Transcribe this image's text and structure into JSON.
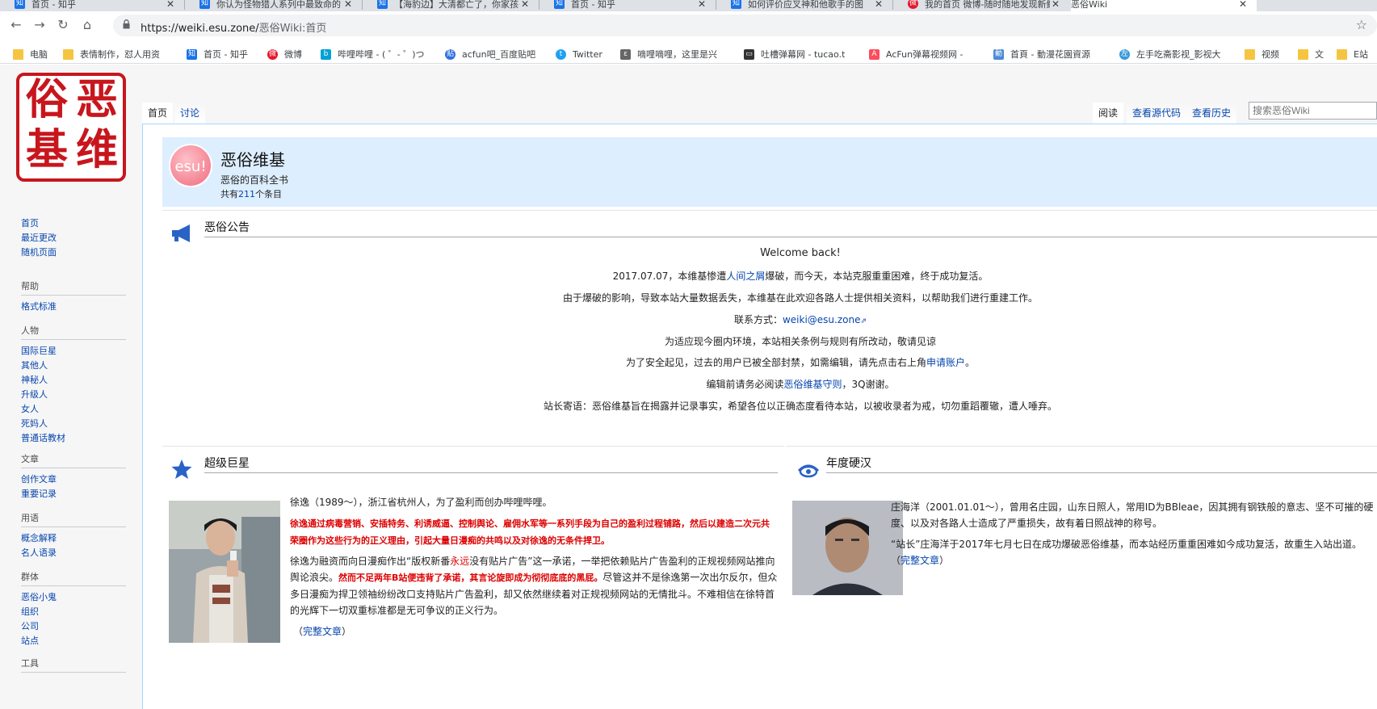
{
  "browser": {
    "tabs": [
      {
        "title": "首页 - 知乎",
        "favicon": "zhihu-favicon"
      },
      {
        "title": "你认为怪物猎人系列中最致命的",
        "favicon": "zhihu-favicon"
      },
      {
        "title": "【海豹边】大清都亡了，你家孩子",
        "favicon": "zhihu-favicon"
      },
      {
        "title": "首页 - 知乎",
        "favicon": "zhihu-favicon"
      },
      {
        "title": "如何评价应叉神和他歌手的图",
        "favicon": "zhihu-favicon"
      },
      {
        "title": "我的首页 微博-随时随地发现新鲜",
        "favicon": "weibo-favicon"
      },
      {
        "title": "恶俗Wiki",
        "favicon": "wiki-favicon"
      }
    ],
    "url": {
      "host": "https://weiki.esu.zone/",
      "path": "恶俗Wiki:首页"
    },
    "bookmarks": [
      {
        "label": "电脑",
        "icon": "folder"
      },
      {
        "label": "表情制作，怼人用资",
        "icon": "folder"
      },
      {
        "label": "首页 - 知乎",
        "icon": "zhihu"
      },
      {
        "label": "微博",
        "icon": "weibo"
      },
      {
        "label": "哔哩哔哩 - ( ゜- ゜)つ",
        "icon": "bili"
      },
      {
        "label": "acfun吧_百度贴吧",
        "icon": "tieba"
      },
      {
        "label": "Twitter",
        "icon": "twitter"
      },
      {
        "label": "嘀哩嘀哩，这里是兴",
        "icon": "nico"
      },
      {
        "label": "吐槽弹幕网 - tucao.t",
        "icon": "tucao"
      },
      {
        "label": "AcFun弹幕视频网 - ",
        "icon": "acfun"
      },
      {
        "label": "首頁 - 動漫花園資源",
        "icon": "dongman"
      },
      {
        "label": "左手吃斋影视_影视大",
        "icon": "zuoshou"
      },
      {
        "label": "视频",
        "icon": "folder"
      },
      {
        "label": "文",
        "icon": "folder"
      },
      {
        "label": "E站",
        "icon": "folder"
      }
    ]
  },
  "sidebar": {
    "logo_text": [
      "恶",
      "俗",
      "维",
      "基"
    ],
    "nav": [
      "首页",
      "最近更改",
      "随机页面"
    ],
    "portals": [
      {
        "heading": "帮助",
        "items": [
          "格式标准"
        ]
      },
      {
        "heading": "人物",
        "items": [
          "国际巨星",
          "其他人",
          "神秘人",
          "升级人",
          "女人",
          "死妈人",
          "普通话教材"
        ]
      },
      {
        "heading": "文章",
        "items": [
          "创作文章",
          "重要记录"
        ]
      },
      {
        "heading": "用语",
        "items": [
          "概念解释",
          "名人语录"
        ]
      },
      {
        "heading": "群体",
        "items": [
          "恶俗小鬼",
          "组织",
          "公司",
          "站点"
        ]
      },
      {
        "heading": "工具",
        "items": []
      }
    ]
  },
  "page_tabs": {
    "left": [
      "首页",
      "讨论"
    ],
    "right": [
      "阅读",
      "查看源代码",
      "查看历史"
    ],
    "search_placeholder": "搜索恶俗Wiki"
  },
  "hero": {
    "badge": "esu!",
    "title": "恶俗维基",
    "subtitle": "恶俗的百科全书",
    "count_prefix": "共有",
    "count": "211",
    "count_suffix": "个条目"
  },
  "notice": {
    "heading": "恶俗公告",
    "line1": "Welcome back!",
    "line2_a": "2017.07.07，本维基惨遭",
    "line2_link": "人间之屑",
    "line2_b": "爆破，而今天，本站克服重重困难，终于成功复活。",
    "line3": "由于爆破的影响，导致本站大量数据丢失，本维基在此欢迎各路人士提供相关资料，以帮助我们进行重建工作。",
    "line4_a": "联系方式：",
    "line4_link": "weiki@esu.zone",
    "line5": "为适应现今圈内环境，本站相关条例与规则有所改动，敬请见谅",
    "line6_a": "为了安全起见，过去的用户已被全部封禁，如需编辑，请先点击右上角",
    "line6_link": "申请账户",
    "line6_b": "。",
    "line7_a": "编辑前请务必阅读",
    "line7_link": "恶俗维基守则",
    "line7_b": "，3Q谢谢。",
    "line8": "站长寄语：恶俗维基旨在揭露并记录事实，希望各位以正确态度看待本站，以被收录者为戒，切勿重蹈覆辙，遭人唾弃。"
  },
  "superstar": {
    "heading": "超级巨星",
    "p1": "徐逸（1989～），浙江省杭州人，为了盈利而创办哔哩哔哩。",
    "p2_red": "徐逸通过病毒营销、安插特务、利诱威逼、控制舆论、雇佣水军等一系列手段为自己的盈利过程铺路，然后以建造二次元共荣圈作为这些行为的正义理由，引起大量日漫痴的共鸣以及对徐逸的无条件捍卫。",
    "p3_a": "徐逸为融资而向日漫痴作出“版权新番",
    "p3_redword": "永远",
    "p3_b": "没有贴片广告”这一承诺，一举把依赖贴片广告盈利的正规视频网站推向舆论浪尖。",
    "p3_red": "然而不足两年B站便违背了承诺，其言论旋即成为彻彻底底的黑屁。",
    "p3_c": "尽管这并不是徐逸第一次出尔反尔，但众多日漫痴为捍卫领袖纷纷改口支持贴片广告盈利，却又依然继续着对正规视频网站的无情批斗。不难相信在徐特首的光辉下一切双重标准都是无可争议的正义行为。",
    "more_a": "（",
    "more_link": "完整文章",
    "more_b": "）"
  },
  "yearly": {
    "heading": "年度硬汉",
    "p1": "庄海洋（2001.01.01～），曾用名庄园，山东日照人，常用ID为BBleae，因其拥有钢铁般的意志、坚不可摧的硬度、以及对各路人士造成了严重损失，故有着日照战神的称号。",
    "p2": "“站长”庄海洋于2017年七月七日在成功爆破恶俗维基，而本站经历重重困难如今成功复活，故重生入站出道。",
    "more_a": "（",
    "more_link": "完整文章",
    "more_b": "）"
  }
}
